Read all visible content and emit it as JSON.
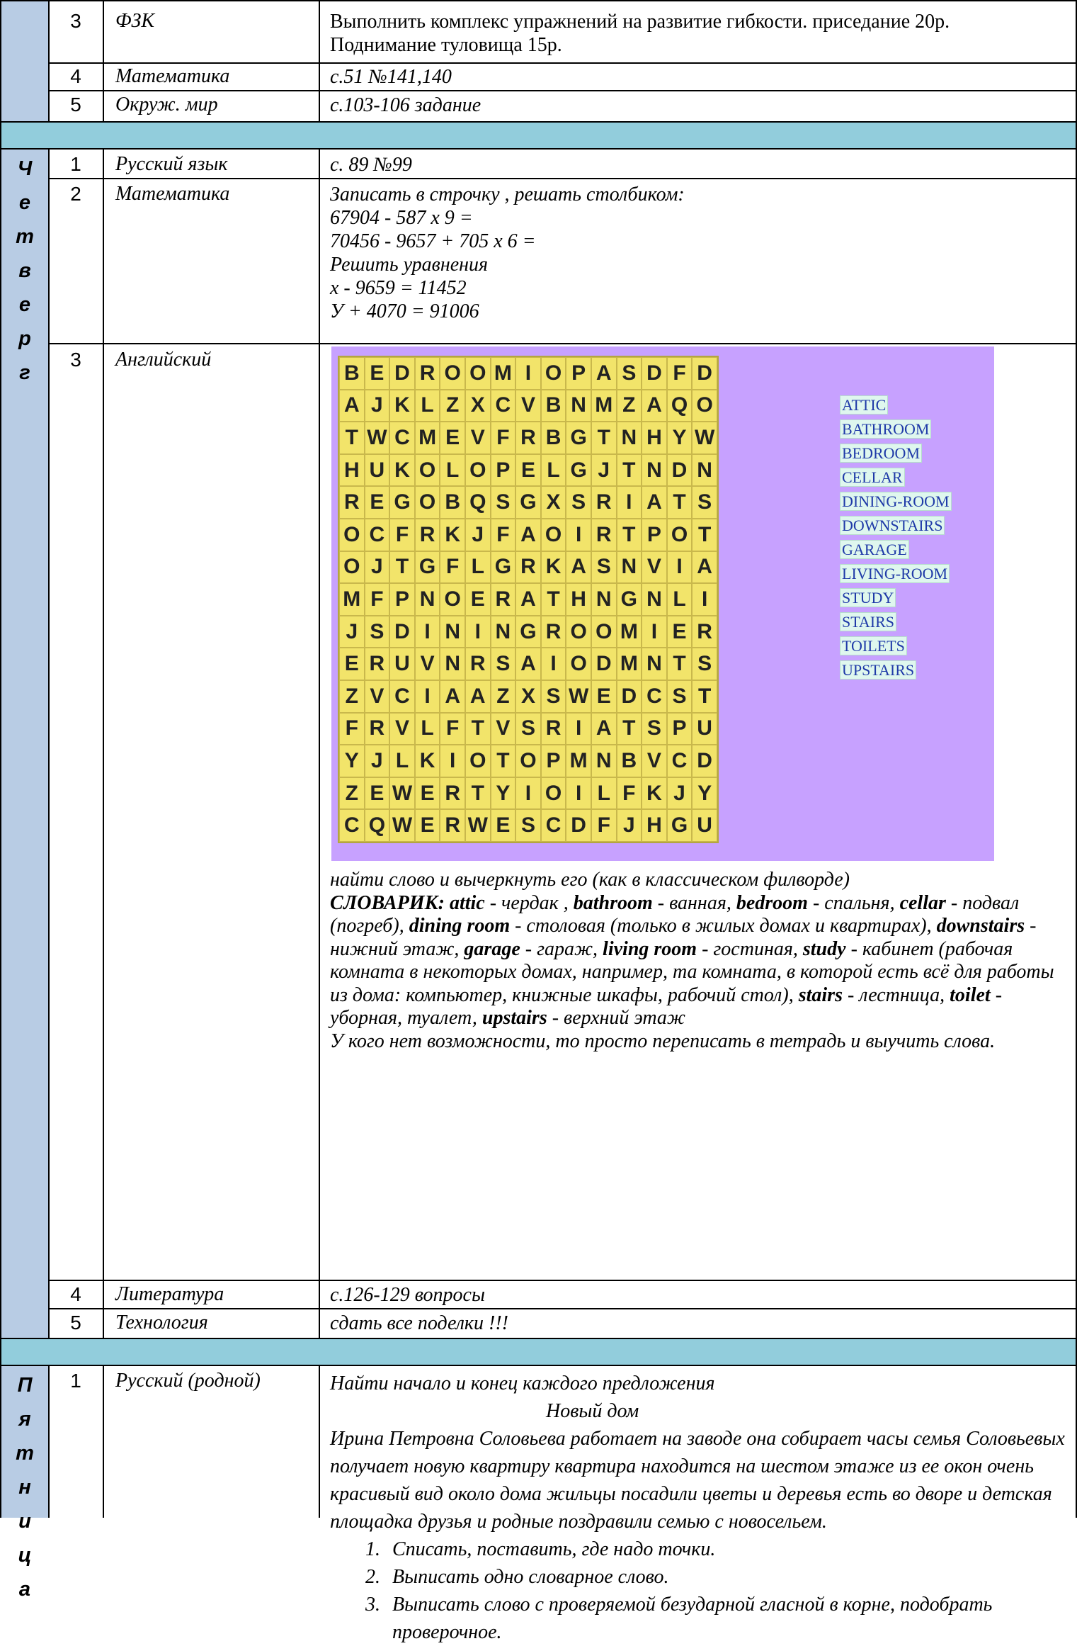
{
  "blockTop": {
    "rows": [
      {
        "num": "3",
        "subject": "ФЗК",
        "task": [
          "Выполнить комплекс упражнений на развитие гибкости. приседание 20р.",
          "Поднимание туловища 15р."
        ]
      },
      {
        "num": "4",
        "subject": "Математика",
        "task": "с.51 №141,140"
      },
      {
        "num": "5",
        "subject": "Окруж. мир",
        "task": "с.103-106 задание"
      }
    ]
  },
  "thursday": {
    "day_letters": [
      "Ч",
      "е",
      "т",
      "в",
      "е",
      "р",
      "г"
    ],
    "rows": [
      {
        "num": "1",
        "subject": "Русский язык",
        "task": "с. 89 №99"
      },
      {
        "num": "2",
        "subject": "Математика",
        "lines": [
          "Записать в строчку , решать столбиком:",
          "67904 - 587 х  9 =",
          "70456 - 9657 + 705 х 6 =",
          "Решить уравнения",
          "х - 9659 = 11452",
          "У + 4070 = 91006"
        ]
      },
      {
        "num": "3",
        "subject": "Английский"
      },
      {
        "num": "4",
        "subject": "Литература",
        "task": "с.126-129 вопросы"
      },
      {
        "num": "5",
        "subject": "Технология",
        "task": "сдать  все поделки !!!"
      }
    ],
    "wordsearch": {
      "rows": [
        "BEDROOMIOPASDFD",
        "AJKLZXCVBNMZAQO",
        "TWCMEVFRBGTNHYW",
        "HUKOLOPELGJTNDN",
        "REGOBQSGXSRIATS",
        "OCFRKJFAOIRTPOT",
        "OJTGFLGRKASNVIA",
        "MFPNOERATHNGNLI",
        "JSDININGROOMIER",
        "ERUVNRSAIODMNTS",
        "ZVCIAAZXSWEDCST",
        "FRVLFTVSRIATSPU",
        "YJLKIOTOPMNBVCD",
        "ZEWERTYIOILFKJY",
        "CQWERWESCDFJHGU"
      ],
      "words": [
        "ATTIC",
        "BATHROOM",
        "BEDROOM",
        "CELLAR",
        "DINING-ROOM",
        "DOWNSTAIRS",
        "GARAGE",
        "LIVING-ROOM",
        "STUDY",
        "STAIRS",
        "TOILETS",
        "UPSTAIRS"
      ]
    },
    "english_instruction": "найти слово и вычеркнуть его (как в классическом филворде)",
    "vocab": {
      "head": "СЛОВАРИК:",
      "entries": [
        {
          "w": "attic",
          "t": " - чердак , "
        },
        {
          "w": "bathroom",
          "t": " - ванная, "
        },
        {
          "w": "bedroom",
          "t": " - спальня, "
        },
        {
          "w": "cellar",
          "t": " - подвал (погреб), "
        },
        {
          "w": "dining room",
          "t": " - столовая (только в жилых домах и квартирах), "
        },
        {
          "w": "downstairs",
          "t": " - нижний этаж, "
        },
        {
          "w": "garage",
          "t": " - гараж, "
        },
        {
          "w": "living room",
          "t": " - гостиная, "
        },
        {
          "w": "study",
          "t": " - кабинет (рабочая комната в некоторых домах, например, та комната, в которой есть всё для работы из дома: компьютер, книжные шкафы, рабочий стол), "
        },
        {
          "w": "stairs",
          "t": " - лестница, "
        },
        {
          "w": "toilet",
          "t": " - уборная, туалет, "
        },
        {
          "w": "upstairs",
          "t": " - верхний этаж"
        }
      ]
    },
    "english_note": "У кого нет возможности, то просто переписать в тетрадь и выучить слова."
  },
  "friday": {
    "day_letters": [
      "П",
      "я",
      "т",
      "н",
      "и",
      "ц",
      "а"
    ],
    "rows": [
      {
        "num": "1",
        "subject": "Русский (родной)"
      }
    ],
    "task_heading": "Найти начало и конец каждого предложения",
    "story_title": "Новый дом",
    "story": "Ирина Петровна Соловьева работает на заводе она собирает часы семья Соловьевых получает новую квартиру квартира находится на шестом этаже из ее окон очень красивый вид около дома жильцы посадили цветы и деревья есть во дворе и детская площадка друзья и родные поздравили семью с новосельем.",
    "steps": [
      {
        "n": "1.",
        "t": "Списать, поставить, где надо точки."
      },
      {
        "n": "2.",
        "t": "Выписать одно словарное слово."
      },
      {
        "n": "3.",
        "t": "Выписать слово с проверяемой безударной гласной в корне, подобрать проверочное."
      }
    ]
  }
}
